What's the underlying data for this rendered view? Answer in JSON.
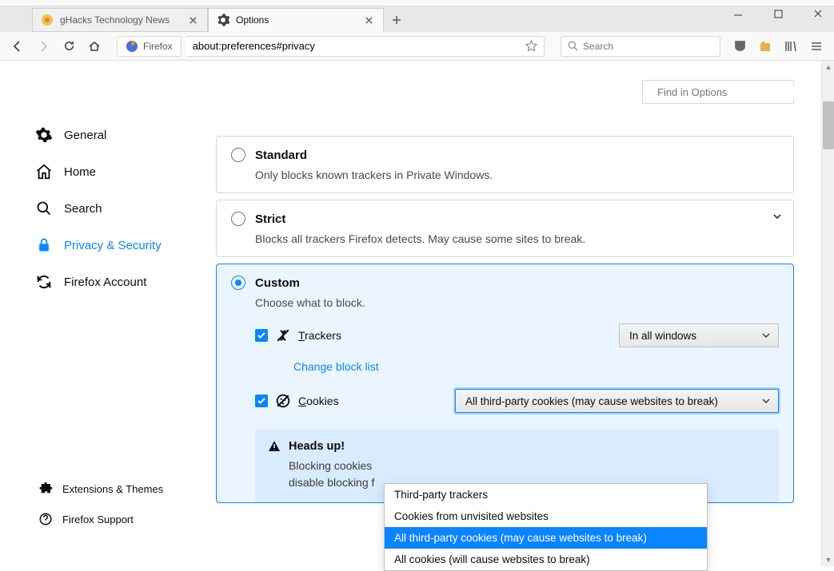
{
  "tabs": [
    {
      "label": "gHacks Technology News"
    },
    {
      "label": "Options"
    }
  ],
  "identity_label": "Firefox",
  "url": "about:preferences#privacy",
  "search_placeholder": "Search",
  "find_placeholder": "Find in Options",
  "sidebar": {
    "items": [
      {
        "label": "General"
      },
      {
        "label": "Home"
      },
      {
        "label": "Search"
      },
      {
        "label": "Privacy & Security"
      },
      {
        "label": "Firefox Account"
      }
    ],
    "bottom": [
      {
        "label": "Extensions & Themes"
      },
      {
        "label": "Firefox Support"
      }
    ]
  },
  "cards": {
    "standard": {
      "title": "Standard",
      "desc": "Only blocks known trackers in Private Windows."
    },
    "strict": {
      "title": "Strict",
      "desc": "Blocks all trackers Firefox detects. May cause some sites to break."
    },
    "custom": {
      "title": "Custom",
      "desc": "Choose what to block.",
      "trackers_label": "Trackers",
      "trackers_select": "In all windows",
      "change_list": "Change block list",
      "cookies_label": "Cookies",
      "cookies_select": "All third-party cookies (may cause websites to break)"
    }
  },
  "dropdown": {
    "items": [
      "Third-party trackers",
      "Cookies from unvisited websites",
      "All third-party cookies (may cause websites to break)",
      "All cookies (will cause websites to break)"
    ]
  },
  "warning": {
    "title": "Heads up!",
    "desc_line1": "Blocking cookies",
    "desc_line2": "disable blocking f"
  }
}
